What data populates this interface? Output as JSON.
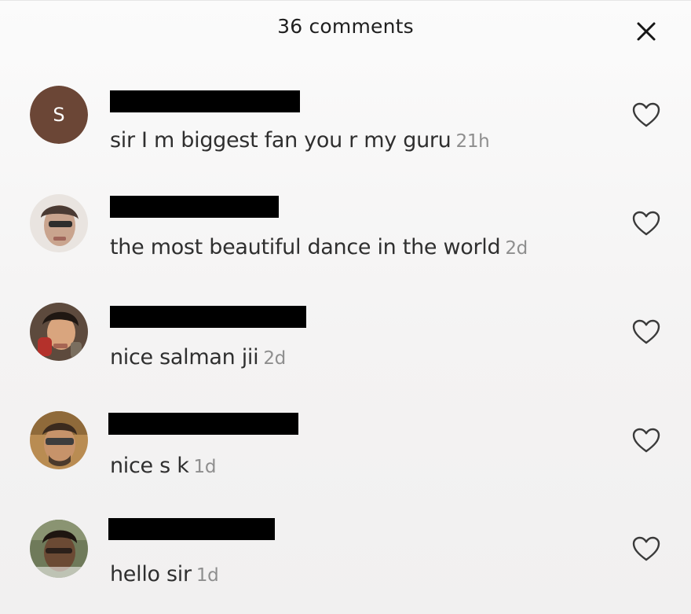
{
  "header": {
    "title": "36 comments",
    "close_icon": "close-icon"
  },
  "comments": [
    {
      "avatar": {
        "type": "letter",
        "letter": "S",
        "color": "#6b4636"
      },
      "username": "redacted",
      "text": "sir I m biggest fan you r my guru",
      "time": "21h",
      "like_icon": "heart-outline-icon"
    },
    {
      "avatar": {
        "type": "photo"
      },
      "username": "redacted",
      "text": "the most beautiful dance in the world",
      "time": "2d",
      "like_icon": "heart-outline-icon"
    },
    {
      "avatar": {
        "type": "photo"
      },
      "username": "redacted",
      "text": "nice salman jii",
      "time": "2d",
      "like_icon": "heart-outline-icon"
    },
    {
      "avatar": {
        "type": "photo"
      },
      "username": "redacted",
      "text": "nice s k",
      "time": "1d",
      "like_icon": "heart-outline-icon"
    },
    {
      "avatar": {
        "type": "photo"
      },
      "username": "redacted",
      "text": "hello sir",
      "time": "1d",
      "like_icon": "heart-outline-icon"
    }
  ]
}
